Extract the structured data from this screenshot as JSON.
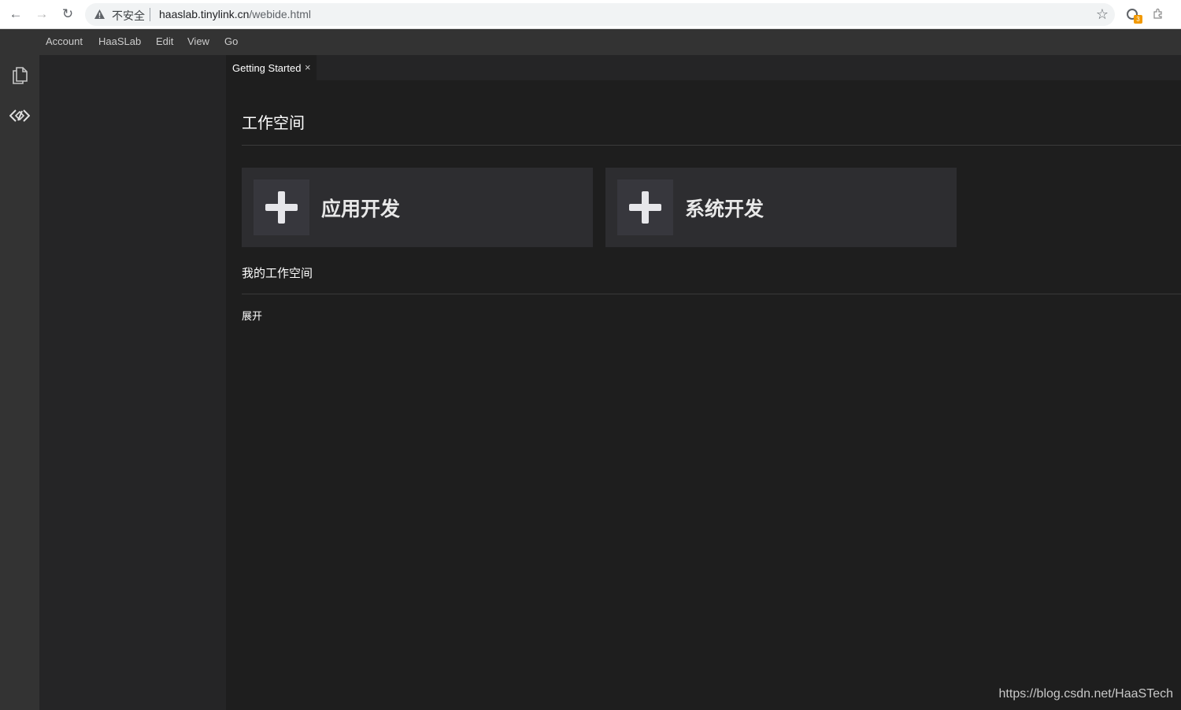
{
  "browser": {
    "security_label": "不安全",
    "url_host": "haaslab.tinylink.cn",
    "url_path": "/webide.html",
    "extension_badge": "3",
    "icons": [
      "back-icon",
      "forward-icon",
      "reload-icon",
      "warning-icon",
      "star-icon",
      "extension-icon",
      "puzzle-icon"
    ]
  },
  "menubar": {
    "items": [
      "Account",
      "HaaSLab",
      "Edit",
      "View",
      "Go"
    ]
  },
  "activity_bar": {
    "icons": [
      "explorer-icon",
      "source-control-icon"
    ]
  },
  "tabs": [
    {
      "label": "Getting Started",
      "close": "×"
    }
  ],
  "workspace": {
    "title": "工作空间",
    "cards": [
      {
        "label": "应用开发",
        "icon": "plus-icon"
      },
      {
        "label": "系统开发",
        "icon": "plus-icon"
      }
    ],
    "my_workspaces_title": "我的工作空间",
    "expand_label": "展开"
  },
  "watermark": "https://blog.csdn.net/HaaSTech",
  "colors": {
    "menubar_bg": "#333333",
    "editor_bg": "#1e1e1e",
    "card_bg": "#2d2d30",
    "text": "#ffffff"
  }
}
